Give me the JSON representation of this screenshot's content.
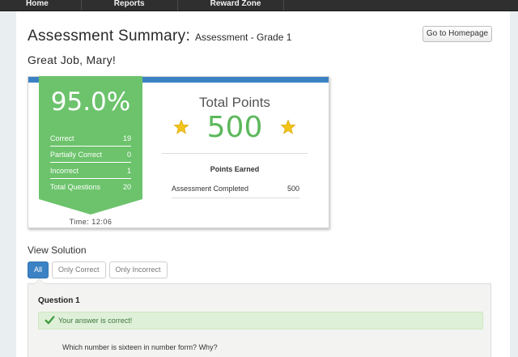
{
  "nav": {
    "items": [
      "Home",
      "Reports",
      "Reward Zone"
    ]
  },
  "header": {
    "title": "Assessment Summary:",
    "subtitle": "Assessment - Grade 1",
    "home_button": "Go to Homepage"
  },
  "greeting": "Great Job, Mary!",
  "score": {
    "percent": "95.0%",
    "stats": [
      {
        "label": "Correct",
        "value": "19"
      },
      {
        "label": "Partially Correct",
        "value": "0"
      },
      {
        "label": "Incorrect",
        "value": "1"
      },
      {
        "label": "Total Questions",
        "value": "20"
      }
    ],
    "time": "Time: 12:06"
  },
  "points": {
    "title": "Total Points",
    "value": "500",
    "earned_title": "Points Earned",
    "earned_rows": [
      {
        "label": "Assessment Completed",
        "value": "500"
      }
    ]
  },
  "solution": {
    "title": "View Solution",
    "filters": [
      "All",
      "Only Correct",
      "Only Incorrect"
    ],
    "active_filter": "All"
  },
  "question": {
    "title": "Question 1",
    "feedback": "Your answer is correct!",
    "text": "Which number is sixteen in number form? Why?"
  },
  "colors": {
    "nav_bg": "#2f2f2f",
    "accent_blue": "#3b82c4",
    "ribbon_green": "#6cc36c",
    "points_green": "#5cb85c",
    "star_yellow": "#f2c31b",
    "alert_bg": "#dff0d8",
    "alert_text": "#3c763d"
  },
  "icons": {
    "star": "star-icon",
    "check": "check-icon"
  }
}
